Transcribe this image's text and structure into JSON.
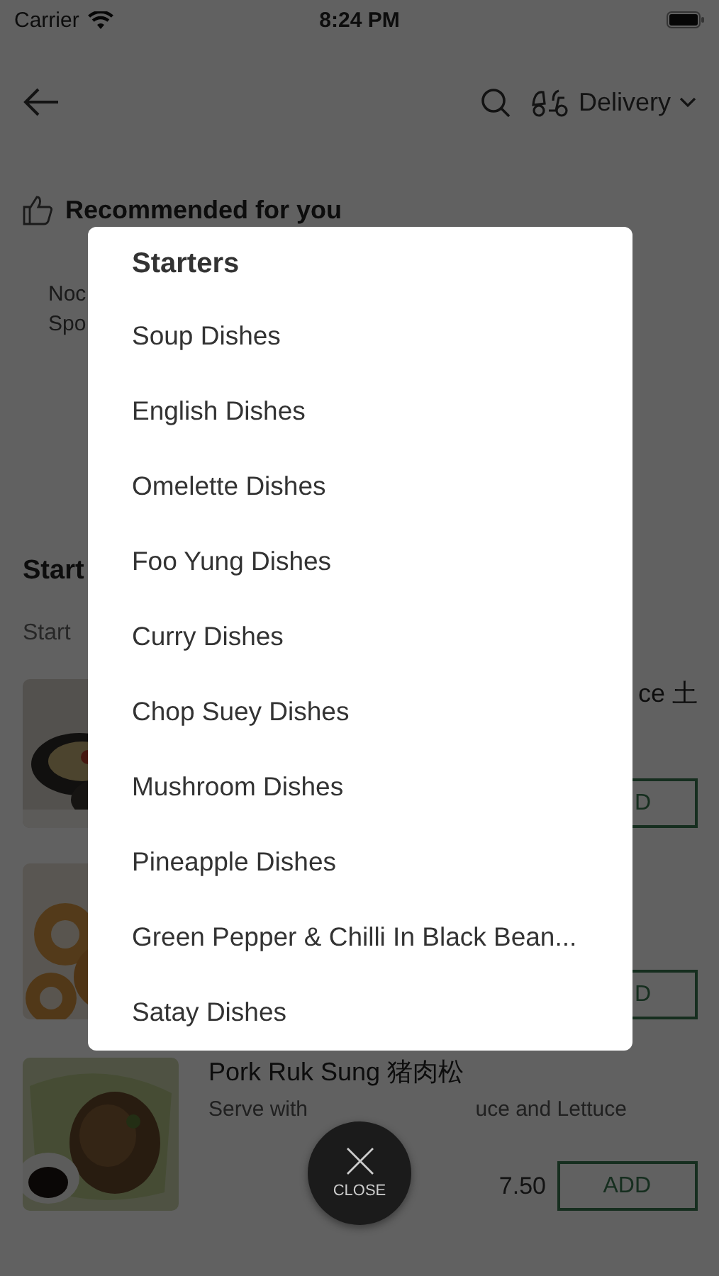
{
  "status_bar": {
    "carrier": "Carrier",
    "time": "8:24 PM"
  },
  "header": {
    "order_mode": "Delivery"
  },
  "recommended": {
    "title": "Recommended for you",
    "card_lines": [
      "Noc",
      "Spo"
    ]
  },
  "section": {
    "title": "Start",
    "subtitle": "Start"
  },
  "items": [
    {
      "name": "ce 土",
      "button": "D"
    },
    {
      "button": "D"
    },
    {
      "name": "Pork Ruk Sung 猪肉松",
      "description": [
        "Serve with",
        "uce and Lettuce"
      ],
      "price": "7.50",
      "button": "ADD"
    }
  ],
  "category_sheet": {
    "title": "Starters",
    "categories": [
      "Soup Dishes",
      "English Dishes",
      "Omelette Dishes",
      "Foo Yung Dishes",
      "Curry Dishes",
      "Chop Suey Dishes",
      "Mushroom Dishes",
      "Pineapple Dishes",
      "Green Pepper & Chilli In Black Bean...",
      "Satay Dishes"
    ]
  },
  "close_button": {
    "label": "CLOSE"
  }
}
